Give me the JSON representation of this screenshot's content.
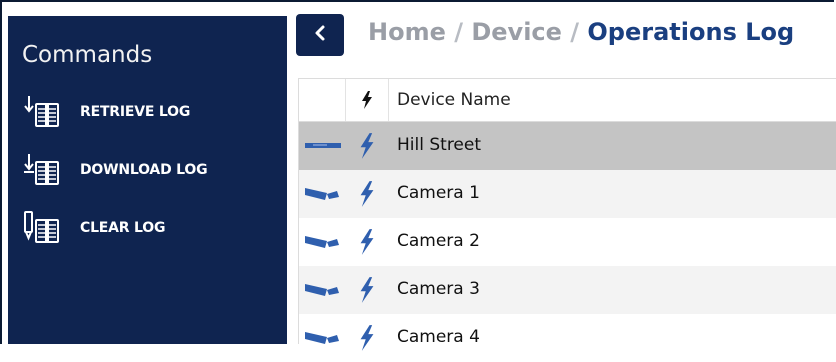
{
  "sidebar": {
    "title": "Commands",
    "commands": [
      {
        "label": "RETRIEVE LOG",
        "icon": "retrieve-log-icon"
      },
      {
        "label": "DOWNLOAD LOG",
        "icon": "download-log-icon"
      },
      {
        "label": "CLEAR LOG",
        "icon": "clear-log-icon"
      }
    ]
  },
  "header": {
    "back_icon": "chevron-left-icon",
    "breadcrumb": [
      "Home",
      "Device",
      "Operations Log"
    ],
    "separator": "/"
  },
  "table": {
    "columns": [
      "",
      "status",
      "Device Name"
    ],
    "rows": [
      {
        "name": "Hill Street",
        "type": "server-icon",
        "status": "lightning-icon",
        "selected": true
      },
      {
        "name": "Camera 1",
        "type": "camera-icon",
        "status": "lightning-icon"
      },
      {
        "name": "Camera 2",
        "type": "camera-icon",
        "status": "lightning-icon"
      },
      {
        "name": "Camera 3",
        "type": "camera-icon",
        "status": "lightning-icon"
      },
      {
        "name": "Camera 4",
        "type": "camera-icon",
        "status": "lightning-icon"
      }
    ]
  },
  "colors": {
    "sidebar_bg": "#0f2450",
    "accent": "#1a3f80",
    "icon_blue": "#2f5fae",
    "selected_row": "#c4c4c4"
  }
}
